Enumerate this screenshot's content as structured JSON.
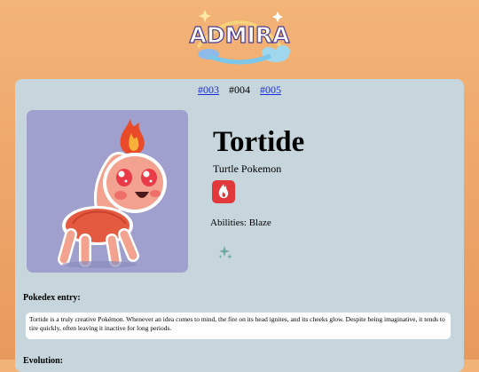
{
  "brand": {
    "logo_text": "ADMIRA"
  },
  "nav": {
    "prev": "#003",
    "current": "#004",
    "next": "#005"
  },
  "pokemon": {
    "name": "Tortide",
    "species": "Turtle Pokemon",
    "type_icon": "fire-icon",
    "abilities": "Abilities: Blaze",
    "sparkle_icon": "sparkle-icon"
  },
  "pokedex": {
    "heading": "Pokedex entry:",
    "entry": "Tortide is a truly creative Pokémon. Whenever an idea comes to mind, the fire on its head ignites, and its cheeks glow. Despite being imaginative, it tends to tire quickly, often leaving it inactive for long periods.",
    "next_heading": "Evolution:"
  },
  "colors": {
    "background": "#eea66a",
    "panel": "#c6d6dc",
    "portrait_bg": "#9fa0cd",
    "type_fire": "#e0383b",
    "link": "#1a2ddb"
  }
}
